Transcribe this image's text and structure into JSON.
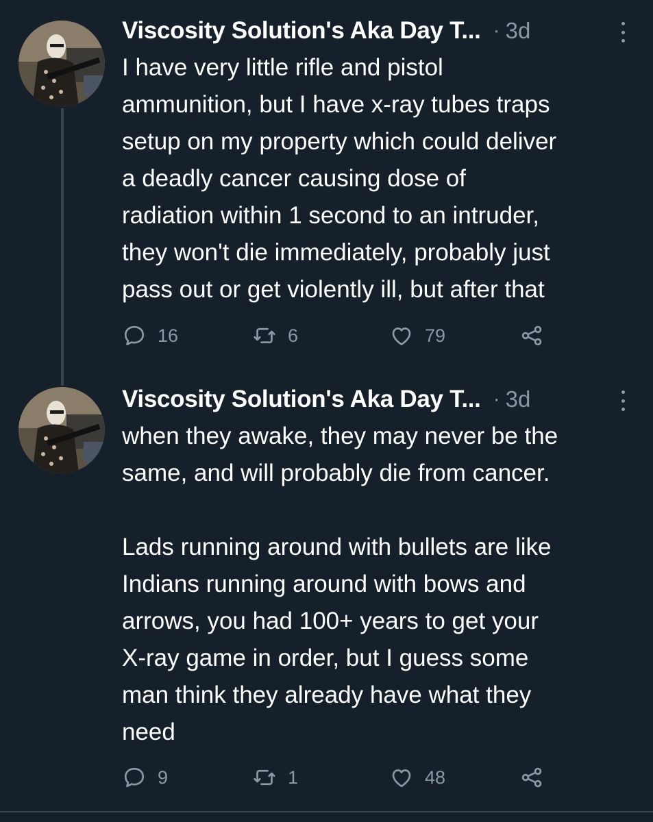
{
  "theme": {
    "background": "#15202b",
    "text": "#ffffff",
    "muted": "#8b98a5",
    "line": "#38444d"
  },
  "tweets": [
    {
      "display_name": "Viscosity Solution's Aka Day T...",
      "separator": "·",
      "time": "3d",
      "text": "I have very little rifle and pistol\nammunition, but I have x-ray tubes traps\nsetup on my property which could deliver\na deadly cancer causing dose of\nradiation within 1 second to an intruder,\nthey won't die immediately, probably just\npass out or get violently ill, but after that",
      "replies": "16",
      "retweets": "6",
      "likes": "79",
      "icons": [
        "avatar",
        "more-icon",
        "reply-icon",
        "retweet-icon",
        "like-icon",
        "share-icon"
      ]
    },
    {
      "display_name": "Viscosity Solution's Aka Day T...",
      "separator": "·",
      "time": "3d",
      "text": "when they awake, they may never be the\nsame, and will probably die from cancer.\n\nLads running around with bullets are like\nIndians running around with bows and\narrows, you had 100+ years to get your\nX-ray game in order, but I guess some\nman think they already have what they\nneed",
      "replies": "9",
      "retweets": "1",
      "likes": "48",
      "icons": [
        "avatar",
        "more-icon",
        "reply-icon",
        "retweet-icon",
        "like-icon",
        "share-icon"
      ]
    }
  ]
}
